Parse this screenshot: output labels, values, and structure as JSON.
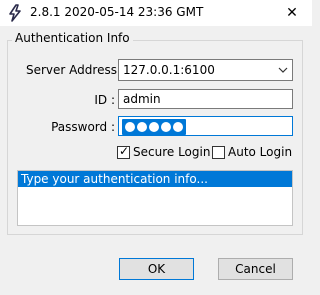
{
  "window": {
    "title": "2.8.1 2020-05-14 23:36 GMT",
    "app_icon": "lightning-logo-icon",
    "close_glyph": "✕"
  },
  "group": {
    "legend": "Authentication Info",
    "server_label": "Server Address :",
    "server_value": "127.0.0.1:6100",
    "id_label": "ID :",
    "id_value": "admin",
    "password_label": "Password :",
    "password_masked_count": 5,
    "secure_login_label": "Secure Login",
    "secure_login_checked": true,
    "auto_login_label": "Auto Login",
    "auto_login_checked": false,
    "info_text": "Type your authentication info..."
  },
  "buttons": {
    "ok_label": "OK",
    "cancel_label": "Cancel"
  },
  "colors": {
    "accent": "#0078d7",
    "window_bg": "#f0f0f0"
  }
}
